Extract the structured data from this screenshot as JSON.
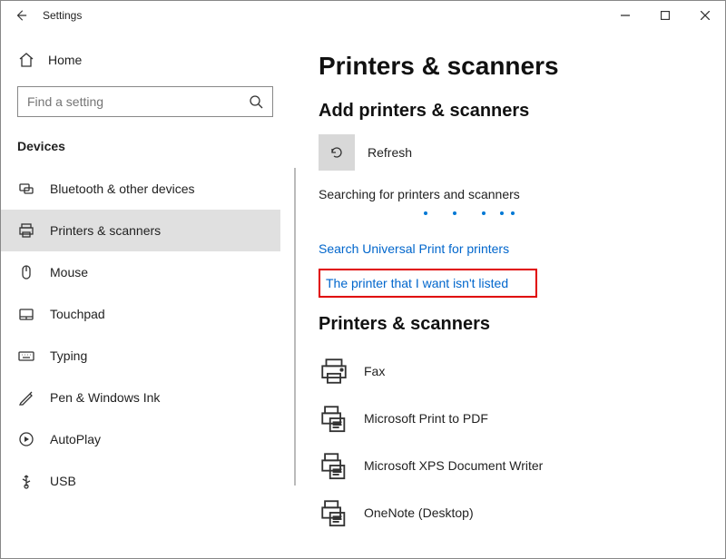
{
  "window": {
    "title": "Settings"
  },
  "sidebar": {
    "home": "Home",
    "search_placeholder": "Find a setting",
    "section": "Devices",
    "items": [
      {
        "label": "Bluetooth & other devices"
      },
      {
        "label": "Printers & scanners"
      },
      {
        "label": "Mouse"
      },
      {
        "label": "Touchpad"
      },
      {
        "label": "Typing"
      },
      {
        "label": "Pen & Windows Ink"
      },
      {
        "label": "AutoPlay"
      },
      {
        "label": "USB"
      }
    ]
  },
  "main": {
    "heading": "Printers & scanners",
    "add_heading": "Add printers & scanners",
    "refresh": "Refresh",
    "searching": "Searching for printers and scanners",
    "link_universal": "Search Universal Print for printers",
    "link_not_listed": "The printer that I want isn't listed",
    "list_heading": "Printers & scanners",
    "devices": [
      {
        "label": "Fax"
      },
      {
        "label": "Microsoft Print to PDF"
      },
      {
        "label": "Microsoft XPS Document Writer"
      },
      {
        "label": "OneNote (Desktop)"
      }
    ]
  }
}
